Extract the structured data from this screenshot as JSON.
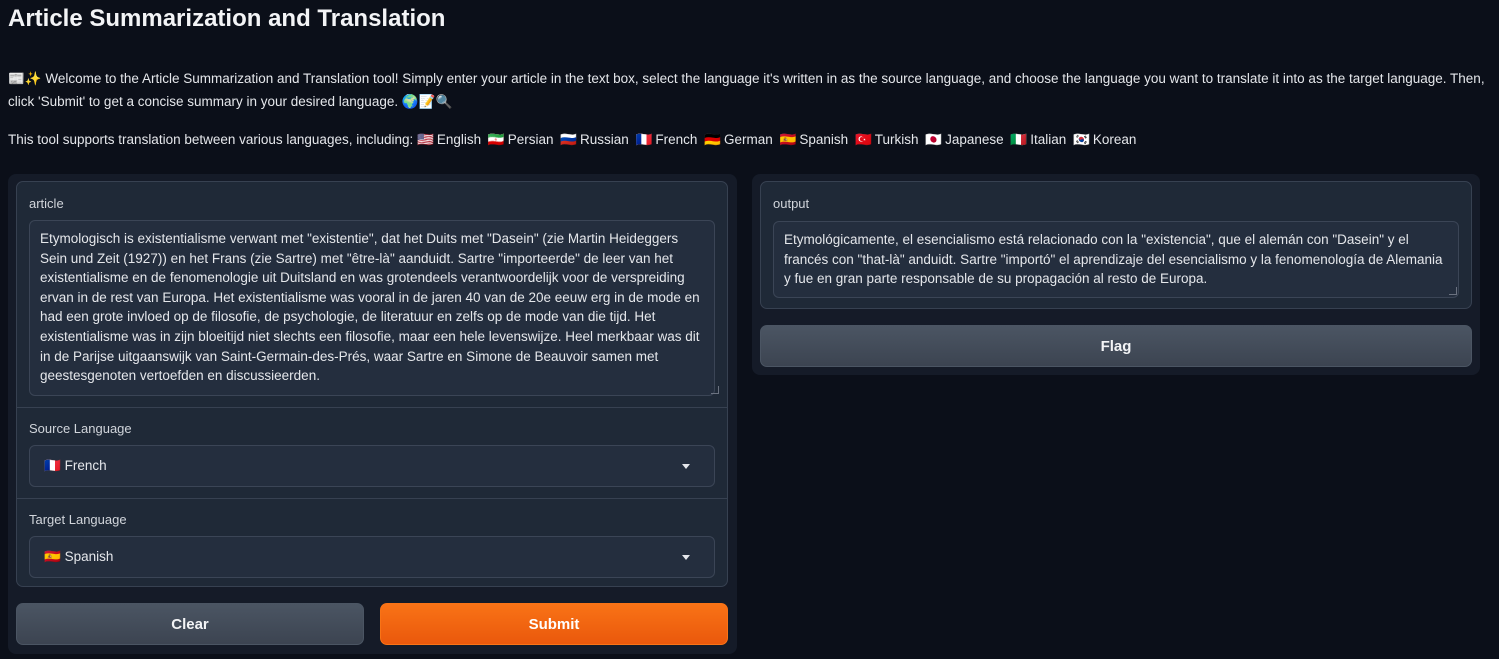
{
  "header": {
    "title": "Article Summarization and Translation",
    "intro_icons": "📰✨",
    "intro_text": "Welcome to the Article Summarization and Translation tool! Simply enter your article in the text box, select the language it's written in as the source language, and choose the language you want to translate it into as the target language. Then, click 'Submit' to get a concise summary in your desired language.",
    "intro_tail_icons": "🌍📝🔍",
    "langs_prefix": "This tool supports translation between various languages, including:"
  },
  "languages": [
    {
      "flag": "🇺🇸",
      "name": "English"
    },
    {
      "flag": "🇮🇷",
      "name": "Persian"
    },
    {
      "flag": "🇷🇺",
      "name": "Russian"
    },
    {
      "flag": "🇫🇷",
      "name": "French"
    },
    {
      "flag": "🇩🇪",
      "name": "German"
    },
    {
      "flag": "🇪🇸",
      "name": "Spanish"
    },
    {
      "flag": "🇹🇷",
      "name": "Turkish"
    },
    {
      "flag": "🇯🇵",
      "name": "Japanese"
    },
    {
      "flag": "🇮🇹",
      "name": "Italian"
    },
    {
      "flag": "🇰🇷",
      "name": "Korean"
    }
  ],
  "form": {
    "article_label": "article",
    "article_value": "Etymologisch is existentialisme verwant met \"existentie\", dat het Duits met \"Dasein\" (zie Martin Heideggers Sein und Zeit (1927)) en het Frans (zie Sartre) met \"être-là\" aanduidt. Sartre \"importeerde\" de leer van het existentialisme en de fenomenologie uit Duitsland en was grotendeels verantwoordelijk voor de verspreiding ervan in de rest van Europa. Het existentialisme was vooral in de jaren 40 van de 20e eeuw erg in de mode en had een grote invloed op de filosofie, de psychologie, de literatuur en zelfs op de mode van die tijd. Het existentialisme was in zijn bloeitijd niet slechts een filosofie, maar een hele levenswijze. Heel merkbaar was dit in de Parijse uitgaanswijk van Saint-Germain-des-Prés, waar Sartre en Simone de Beauvoir samen met geestesgenoten vertoefden en discussieerden.",
    "source_label": "Source Language",
    "source_flag": "🇫🇷",
    "source_value": "French",
    "target_label": "Target Language",
    "target_flag": "🇪🇸",
    "target_value": "Spanish",
    "clear_label": "Clear",
    "submit_label": "Submit"
  },
  "output": {
    "label": "output",
    "value": "Etymológicamente, el esencialismo está relacionado con la \"existencia\", que el alemán con \"Dasein\" y el francés con \"that-là\" anduidt. Sartre \"importó\" el aprendizaje del esencialismo y la fenomenología de Alemania y fue en gran parte responsable de su propagación al resto de Europa.",
    "flag_label": "Flag"
  },
  "colors": {
    "background": "#0b0f19",
    "panel": "#151b28",
    "accent": "#f97316"
  }
}
